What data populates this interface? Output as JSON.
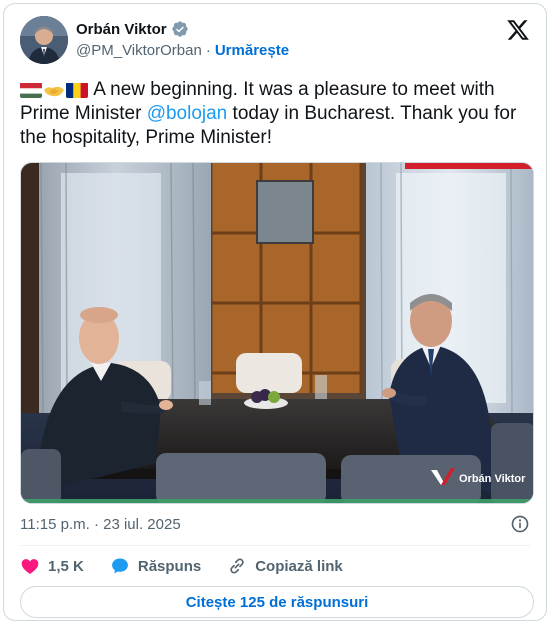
{
  "author": {
    "name": "Orbán Viktor",
    "handle": "@PM_ViktorOrban",
    "separator": "·",
    "follow_label": "Urmărește"
  },
  "tweet": {
    "flags_and_emoji": [
      "hungary-flag",
      "handshake",
      "romania-flag"
    ],
    "text_before": " A new beginning. It was a pleasure to meet with Prime Minister ",
    "mention": "@bolojan",
    "text_after": " today in Bucharest. Thank you for the hospitality, Prime Minister!"
  },
  "media": {
    "watermark": "Orbán Viktor"
  },
  "meta": {
    "time": "11:15 p.m.",
    "separator": "·",
    "date": "23 iul. 2025"
  },
  "actions": {
    "likes": "1,5 K",
    "reply_label": "Răspuns",
    "copy_link_label": "Copiază link"
  },
  "read_replies_label": "Citește 125 de răspunsuri",
  "colors": {
    "accent": "#1d9bf0",
    "link": "#006fd6",
    "like": "#f91880",
    "text": "#0f1419",
    "muted": "#536471",
    "border": "#cfd9de"
  }
}
